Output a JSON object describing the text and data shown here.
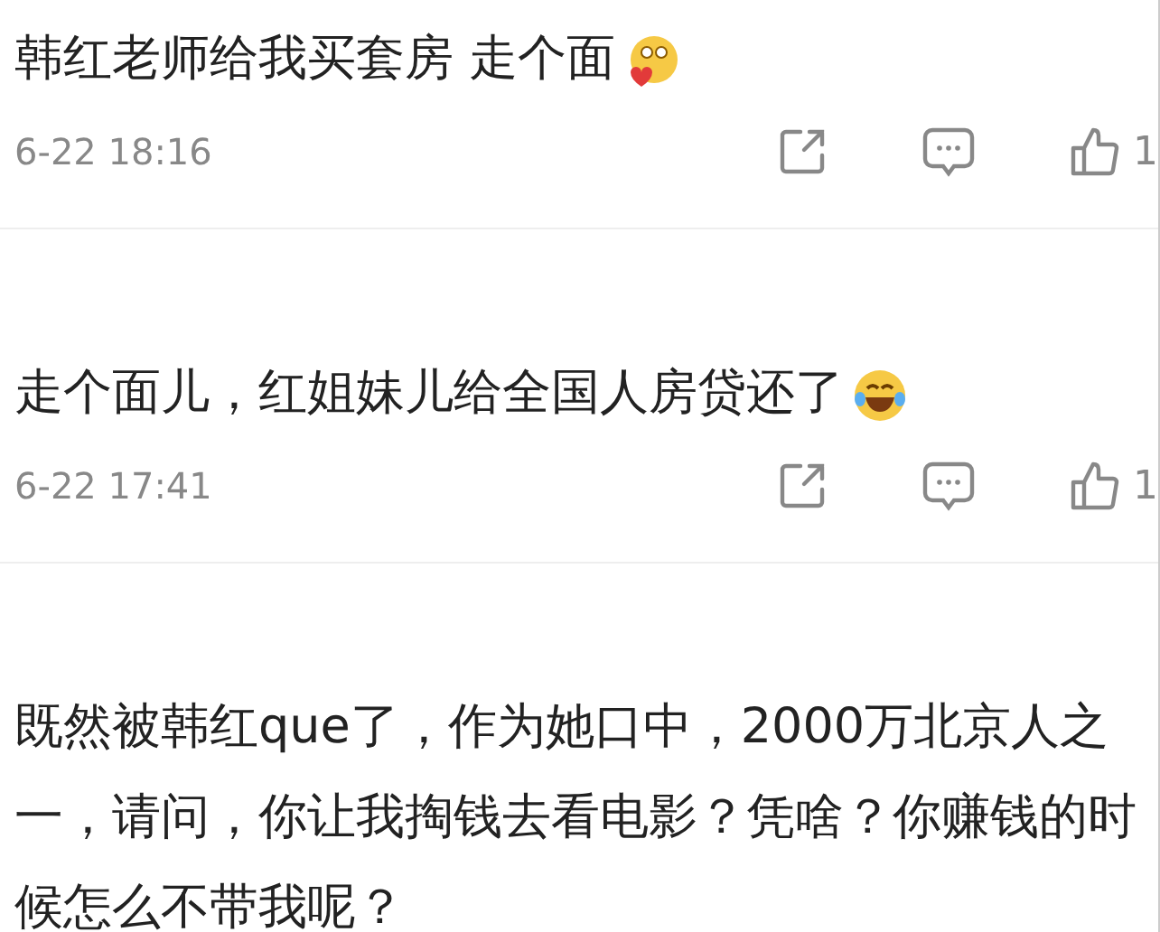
{
  "comments": [
    {
      "text": "韩红老师给我买套房 走个面",
      "emoji": {
        "kind": "kiss"
      },
      "time": "6-22 18:16",
      "likes": "1"
    },
    {
      "text": "走个面儿，红姐妹儿给全国人房贷还了",
      "emoji": {
        "kind": "laugh"
      },
      "time": "6-22 17:41",
      "likes": "1"
    },
    {
      "text": "既然被韩红que了，作为她口中，2000万北京人之一，请问，你让我掏钱去看电影？凭啥？你赚钱的时候怎么不带我呢？"
    }
  ]
}
